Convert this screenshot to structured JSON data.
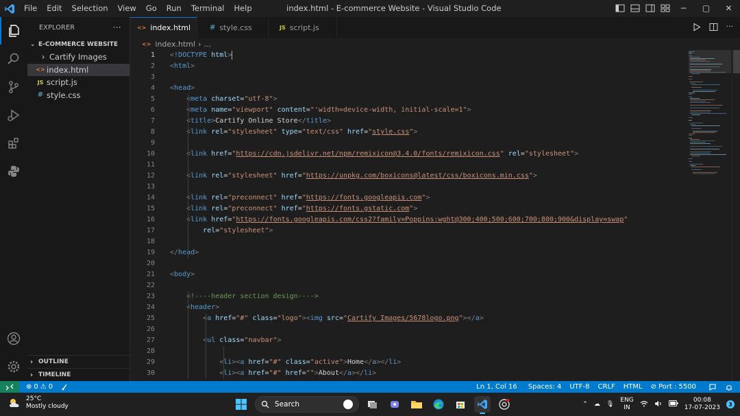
{
  "titlebar": {
    "menus": [
      "File",
      "Edit",
      "Selection",
      "View",
      "Go",
      "Run",
      "Terminal",
      "Help"
    ],
    "title": "index.html - E-commerce Website - Visual Studio Code",
    "controls": [
      "─",
      "▢",
      "✕"
    ]
  },
  "sidebar": {
    "header": "EXPLORER",
    "more": "···",
    "folder": "E-COMMERCE WEBSITE",
    "items": [
      {
        "label": "Cartify Images",
        "icon": "chevron-right-icon",
        "badge": "›"
      },
      {
        "label": "index.html",
        "icon": "html-file-icon",
        "badge": "<>"
      },
      {
        "label": "script.js",
        "icon": "js-file-icon",
        "badge": "JS"
      },
      {
        "label": "style.css",
        "icon": "css-file-icon",
        "badge": "#"
      }
    ],
    "outline": "OUTLINE",
    "timeline": "TIMELINE"
  },
  "tabs": [
    {
      "label": "index.html",
      "icon": "<>",
      "active": true,
      "close": "✕"
    },
    {
      "label": "style.css",
      "icon": "#",
      "active": false
    },
    {
      "label": "script.js",
      "icon": "JS",
      "active": false
    }
  ],
  "breadcrumb": {
    "file": "index.html",
    "sep": "›",
    "rest": "..."
  },
  "editor": {
    "current_line": 1,
    "lines": [
      {
        "n": "1",
        "html": "<span class='t'>&lt;</span><span class='tg'>!DOCTYPE</span> <span class='at'>html</span><span class='t'>&gt;</span><span class='cursor'></span>"
      },
      {
        "n": "2",
        "html": "<span class='t'>&lt;</span><span class='tg'>html</span><span class='t'>&gt;</span>"
      },
      {
        "n": "3",
        "html": ""
      },
      {
        "n": "4",
        "html": "<span class='t'>&lt;</span><span class='tg'>head</span><span class='t'>&gt;</span>"
      },
      {
        "n": "5",
        "html": "    <span class='t'>&lt;</span><span class='tg'>meta</span> <span class='at'>charset</span><span class='tx'>=</span><span class='st'>\"utf-8\"</span><span class='t'>&gt;</span>"
      },
      {
        "n": "6",
        "html": "    <span class='t'>&lt;</span><span class='tg'>meta</span> <span class='at'>name</span><span class='tx'>=</span><span class='st'>\"viewport\"</span> <span class='at'>content</span><span class='tx'>=</span><span class='st'>\"'width=device-width, initial-scale=1\"</span><span class='t'>&gt;</span>"
      },
      {
        "n": "7",
        "html": "    <span class='t'>&lt;</span><span class='tg'>title</span><span class='t'>&gt;</span><span class='tx'>Cartify Online Store</span><span class='t'>&lt;/</span><span class='tg'>title</span><span class='t'>&gt;</span>"
      },
      {
        "n": "8",
        "html": "    <span class='t'>&lt;</span><span class='tg'>link</span> <span class='at'>rel</span><span class='tx'>=</span><span class='st'>\"stylesheet\"</span> <span class='at'>type</span><span class='tx'>=</span><span class='st'>\"text/css\"</span> <span class='at'>href</span><span class='tx'>=</span><span class='st'>\"<span class='u'>style.css</span>\"</span><span class='t'>&gt;</span>"
      },
      {
        "n": "9",
        "html": ""
      },
      {
        "n": "10",
        "html": "    <span class='t'>&lt;</span><span class='tg'>link</span> <span class='at'>href</span><span class='tx'>=</span><span class='st'>\"<span class='u'>https://cdn.jsdelivr.net/npm/remixicon@3.4.0/fonts/remixicon.css</span>\"</span> <span class='at'>rel</span><span class='tx'>=</span><span class='st'>\"stylesheet\"</span><span class='t'>&gt;</span>"
      },
      {
        "n": "11",
        "html": ""
      },
      {
        "n": "12",
        "html": "    <span class='t'>&lt;</span><span class='tg'>link</span> <span class='at'>rel</span><span class='tx'>=</span><span class='st'>\"stylesheet\"</span> <span class='at'>href</span><span class='tx'>=</span><span class='st'>\"<span class='u'>https://unpkg.com/boxicons@latest/css/boxicons.min.css</span>\"</span><span class='t'>&gt;</span>"
      },
      {
        "n": "13",
        "html": ""
      },
      {
        "n": "14",
        "html": "    <span class='t'>&lt;</span><span class='tg'>link</span> <span class='at'>rel</span><span class='tx'>=</span><span class='st'>\"preconnect\"</span> <span class='at'>href</span><span class='tx'>=</span><span class='st'>\"<span class='u'>https://fonts.googleapis.com</span>\"</span><span class='t'>&gt;</span>"
      },
      {
        "n": "15",
        "html": "    <span class='t'>&lt;</span><span class='tg'>link</span> <span class='at'>rel</span><span class='tx'>=</span><span class='st'>\"preconnect\"</span> <span class='at'>href</span><span class='tx'>=</span><span class='st'>\"<span class='u'>https://fonts.gstatic.com</span>\"</span><span class='t'>&gt;</span>"
      },
      {
        "n": "16",
        "html": "    <span class='t'>&lt;</span><span class='tg'>link</span> <span class='at'>href</span><span class='tx'>=</span><span class='st'>\"<span class='u'>https://fonts.googleapis.com/css2?family=Poppins:wght@300;400;500;600;700;800;900&amp;display=swap</span>\"</span>"
      },
      {
        "n": "17",
        "html": "        <span class='at'>rel</span><span class='tx'>=</span><span class='st'>\"stylesheet\"</span><span class='t'>&gt;</span>"
      },
      {
        "n": "18",
        "html": ""
      },
      {
        "n": "19",
        "html": "<span class='t'>&lt;/</span><span class='tg'>head</span><span class='t'>&gt;</span>"
      },
      {
        "n": "20",
        "html": ""
      },
      {
        "n": "21",
        "html": "<span class='t'>&lt;</span><span class='tg'>body</span><span class='t'>&gt;</span>"
      },
      {
        "n": "22",
        "html": ""
      },
      {
        "n": "23",
        "html": "    <span class='cm'>&lt;!----header section design----&gt;</span>"
      },
      {
        "n": "24",
        "html": "    <span class='t'>&lt;</span><span class='tg'>header</span><span class='t'>&gt;</span>"
      },
      {
        "n": "25",
        "html": "        <span class='t'>&lt;</span><span class='tg'>a</span> <span class='at'>href</span><span class='tx'>=</span><span class='st'>\"#\"</span> <span class='at'>class</span><span class='tx'>=</span><span class='st'>\"logo\"</span><span class='t'>&gt;&lt;</span><span class='tg'>img</span> <span class='at'>src</span><span class='tx'>=</span><span class='st'>\"<span class='u'>Cartify Images/5678logo.png</span>\"</span><span class='t'>&gt;&lt;/</span><span class='tg'>a</span><span class='t'>&gt;</span>"
      },
      {
        "n": "26",
        "html": ""
      },
      {
        "n": "27",
        "html": "        <span class='t'>&lt;</span><span class='tg'>ul</span> <span class='at'>class</span><span class='tx'>=</span><span class='st'>\"navbar\"</span><span class='t'>&gt;</span>"
      },
      {
        "n": "28",
        "html": ""
      },
      {
        "n": "29",
        "html": "            <span class='t'>&lt;</span><span class='tg'>li</span><span class='t'>&gt;&lt;</span><span class='tg'>a</span> <span class='at'>href</span><span class='tx'>=</span><span class='st'>\"#\"</span> <span class='at'>class</span><span class='tx'>=</span><span class='st'>\"active\"</span><span class='t'>&gt;</span><span class='tx'>Home</span><span class='t'>&lt;/</span><span class='tg'>a</span><span class='t'>&gt;&lt;/</span><span class='tg'>li</span><span class='t'>&gt;</span>"
      },
      {
        "n": "30",
        "html": "            <span class='t'>&lt;</span><span class='tg'>li</span><span class='t'>&gt;&lt;</span><span class='tg'>a</span> <span class='at'>href</span><span class='tx'>=</span><span class='st'>\"#\"</span> <span class='at'>href</span><span class='tx'>=</span><span class='st'>\"\"</span><span class='t'>&gt;</span><span class='tx'>About</span><span class='t'>&lt;/</span><span class='tg'>a</span><span class='t'>&gt;&lt;/</span><span class='tg'>li</span><span class='t'>&gt;</span>"
      }
    ]
  },
  "statusbar": {
    "errors": "0",
    "warnings": "0",
    "position": "Ln 1, Col 16",
    "spaces": "Spaces: 4",
    "encoding": "UTF-8",
    "eol": "CRLF",
    "language": "HTML",
    "port": "Port : 5500"
  },
  "taskbar": {
    "temperature": "25°C",
    "weather": "Mostly cloudy",
    "search": "Search",
    "lang": "ENG",
    "region": "IN",
    "time": "00:08",
    "date": "17-07-2023",
    "notifications": "3"
  },
  "colors": {
    "accent": "#007acc",
    "remote": "#16825d",
    "tag": "#569cd6",
    "attr": "#9cdcfe",
    "string": "#ce9178",
    "comment": "#6a9955"
  }
}
